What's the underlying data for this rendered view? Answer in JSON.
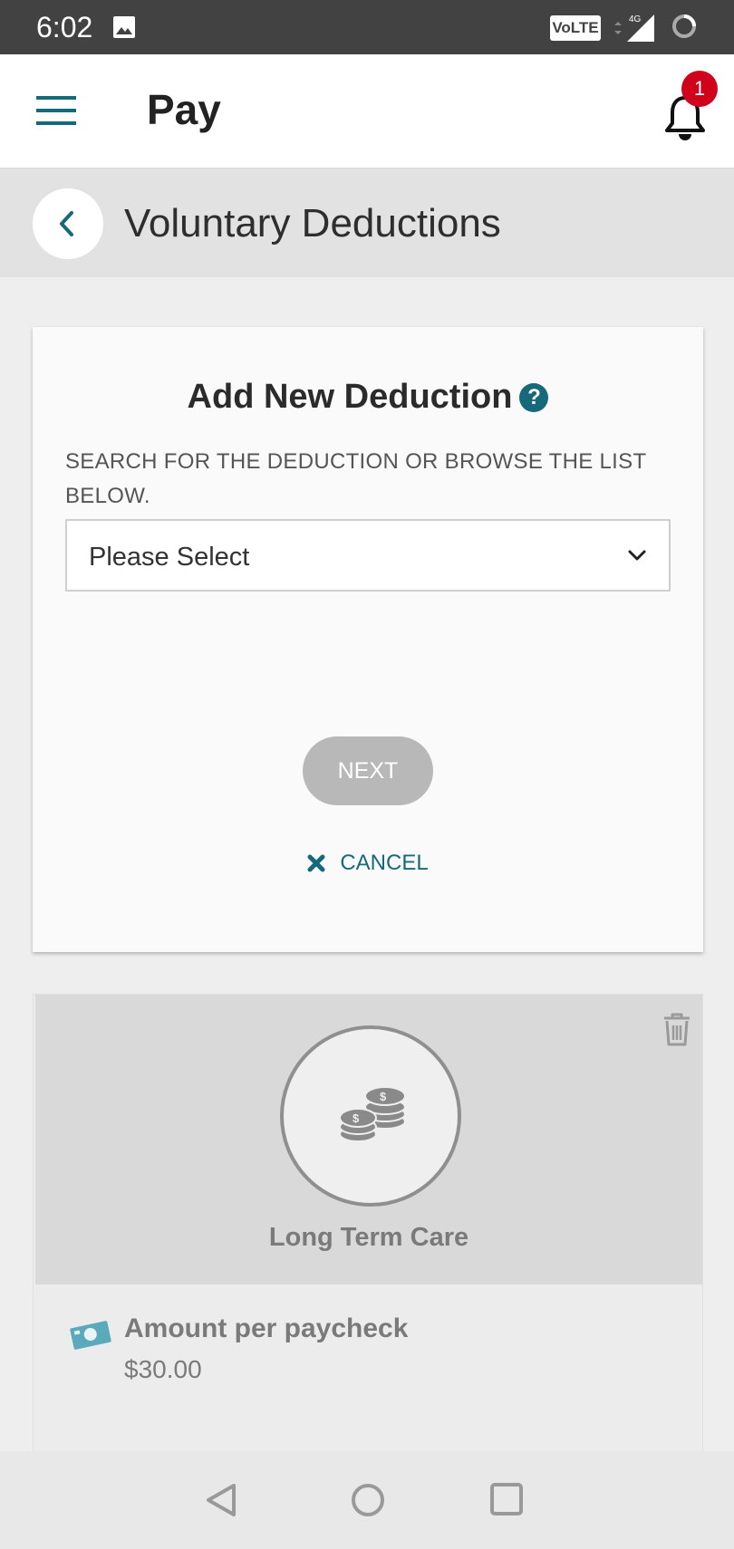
{
  "status_bar": {
    "time": "6:02",
    "volte": "VoLTE",
    "network": "4G",
    "icons": [
      "image-icon",
      "signal-icon",
      "loading-icon"
    ]
  },
  "app_bar": {
    "title": "Pay",
    "notification_count": "1"
  },
  "page_header": {
    "title": "Voluntary Deductions"
  },
  "add_deduction": {
    "title": "Add New Deduction",
    "help_glyph": "?",
    "search_label": "SEARCH FOR THE DEDUCTION OR BROWSE THE LIST BELOW.",
    "select_value": "Please Select",
    "next_label": "NEXT",
    "cancel_label": "CANCEL"
  },
  "deduction_card": {
    "name": "Long Term Care",
    "amount_label": "Amount per paycheck",
    "amount_value": "$30.00"
  },
  "colors": {
    "accent": "#16697a",
    "badge": "#d0021b",
    "disabled_button": "#b8b8b8",
    "status_bar": "#424242"
  }
}
